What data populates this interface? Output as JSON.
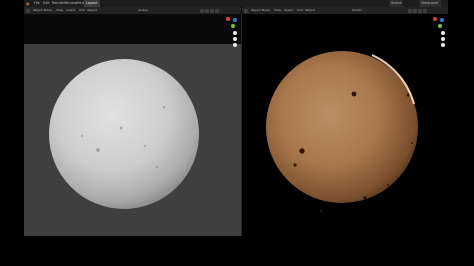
{
  "app": {
    "name": "Blender"
  },
  "menu": {
    "items": [
      "File",
      "Edit",
      "Render",
      "Window",
      "Help"
    ],
    "workspace_tab": "Layout",
    "right_tabs": [
      "Scene",
      "ViewLayer"
    ]
  },
  "viewports": [
    {
      "mode": "Object Mode",
      "menus": [
        "View",
        "Select",
        "Add",
        "Object"
      ],
      "transform": "Global",
      "shading": "solid"
    },
    {
      "mode": "Object Mode",
      "menus": [
        "View",
        "Select",
        "Add",
        "Object"
      ],
      "transform": "Global",
      "shading": "rendered"
    }
  ],
  "icons": {
    "axis_x": "#e0413f",
    "axis_y": "#7fbf2f",
    "axis_z": "#3c73d6"
  },
  "colors": {
    "viewport_bg_left": "#3f3f3f",
    "viewport_bg_right": "#000000",
    "solid_sphere": "#c9c9c9",
    "rendered_sphere": "#b07a4e"
  }
}
